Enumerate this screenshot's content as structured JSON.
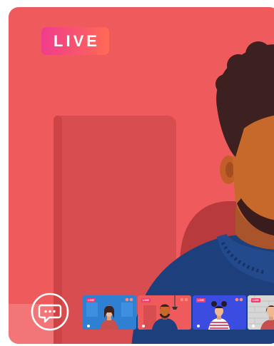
{
  "stream": {
    "badge_label": "LIVE",
    "accent_color": "#f03c8c",
    "background_color": "#ef5a5c"
  },
  "controls": {
    "chat_icon": "chat-bubble-icon"
  },
  "thumbnails": [
    {
      "badge": "LIVE",
      "bg": "#2f7fd2"
    },
    {
      "badge": "LIVE",
      "bg": "#ef5a5c"
    },
    {
      "badge": "LIVE",
      "bg": "#3a4de0"
    },
    {
      "badge": "LIVE",
      "bg": "#d6d6d6"
    }
  ]
}
